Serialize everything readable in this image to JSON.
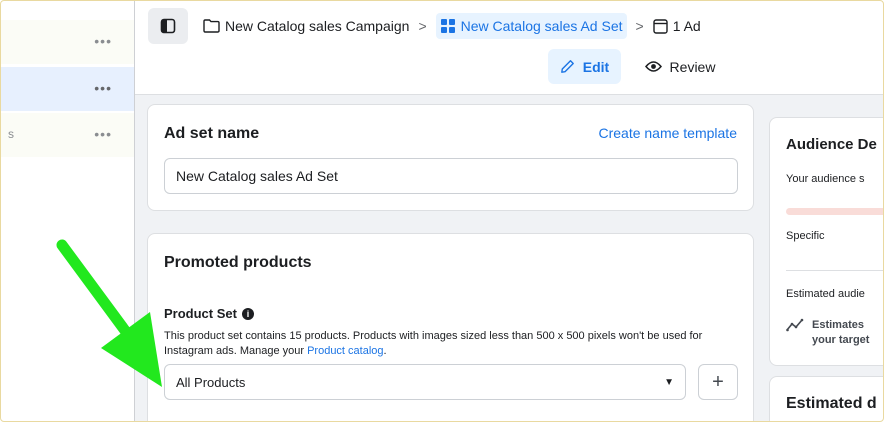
{
  "breadcrumb": {
    "campaign": "New Catalog sales Campaign",
    "ad_set": "New Catalog sales Ad Set",
    "ad": "1 Ad",
    "separator": ">"
  },
  "left_panel": {
    "rows": [
      {
        "dots": "•••",
        "stub": ""
      },
      {
        "dots": "•••",
        "stub": ""
      },
      {
        "dots": "•••",
        "stub": "s"
      }
    ]
  },
  "toolbar": {
    "edit_label": "Edit",
    "review_label": "Review"
  },
  "ad_set_name": {
    "title": "Ad set name",
    "template_link": "Create name template",
    "value": "New Catalog sales Ad Set"
  },
  "promoted_products": {
    "title": "Promoted products",
    "product_set_label": "Product Set",
    "help_text": "This product set contains 15 products. Products with images sized less than 500 x 500 pixels won't be used for Instagram ads. Manage your ",
    "help_link": "Product catalog",
    "help_end": ".",
    "selected_set": "All Products",
    "add_label": "+"
  },
  "audience": {
    "title": "Audience De",
    "size_text": "Your audience s",
    "specific_label": "Specific",
    "estimated_label": "Estimated audie",
    "note_line1": "Estimates",
    "note_line2": "your target"
  },
  "estimated": {
    "title": "Estimated d"
  },
  "colors": {
    "accent": "#1b74e4",
    "accent_bg": "#e7f3ff",
    "annotation_arrow": "#22e81e"
  }
}
